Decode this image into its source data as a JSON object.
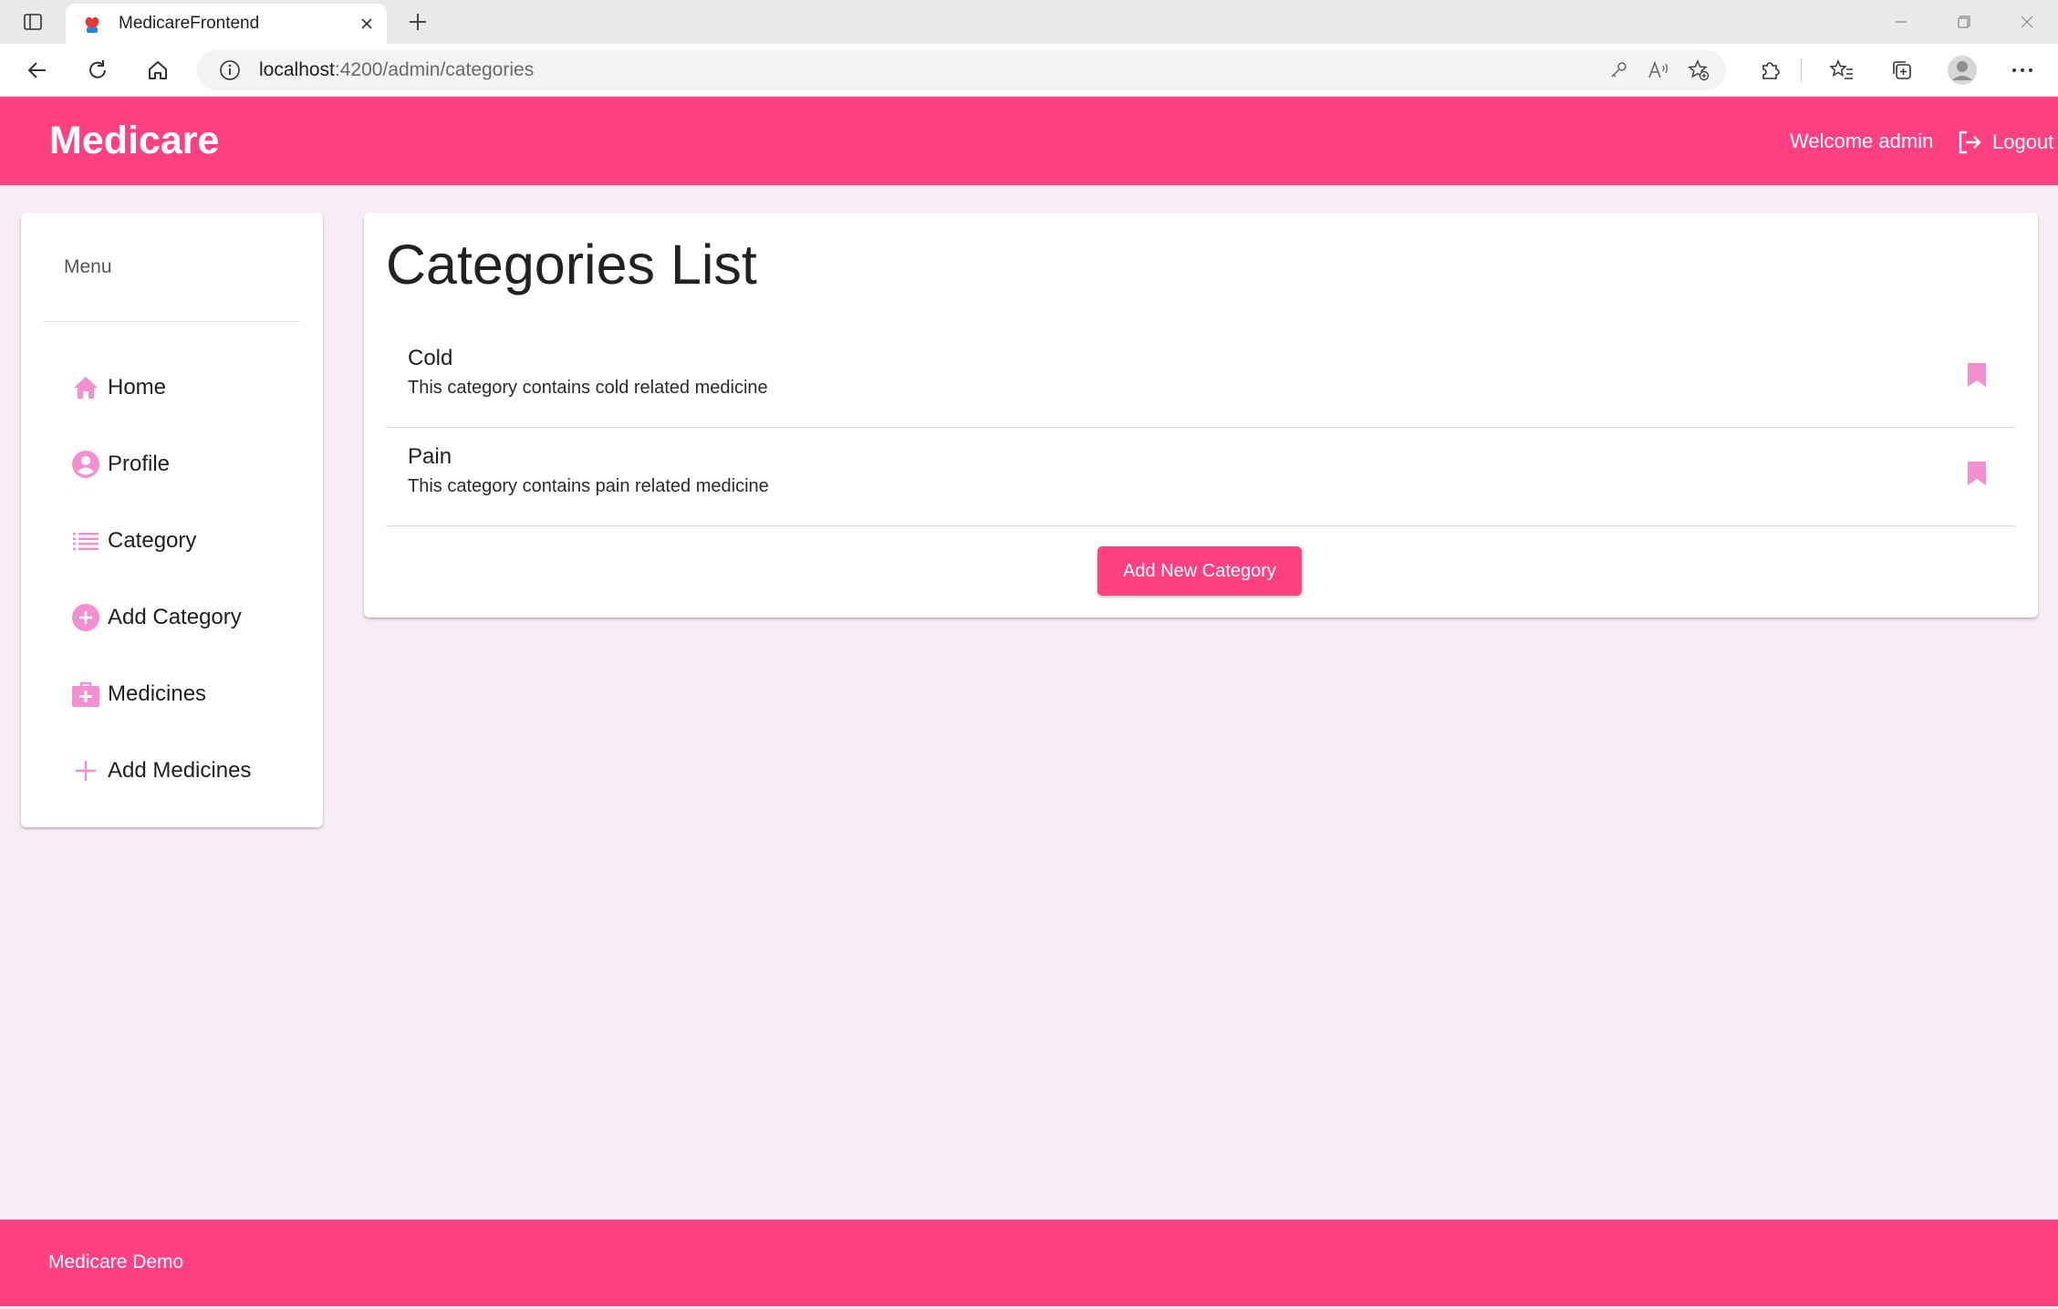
{
  "browser": {
    "tab_title": "MedicareFrontend",
    "url_host": "localhost",
    "url_path": ":4200/admin/categories"
  },
  "header": {
    "brand": "Medicare",
    "welcome": "Welcome admin",
    "logout_label": "Logout"
  },
  "sidebar": {
    "heading": "Menu",
    "items": [
      {
        "label": "Home",
        "icon": "home-icon"
      },
      {
        "label": "Profile",
        "icon": "account-circle-icon"
      },
      {
        "label": "Category",
        "icon": "list-icon"
      },
      {
        "label": "Add Category",
        "icon": "add-circle-icon"
      },
      {
        "label": "Medicines",
        "icon": "medical-kit-icon"
      },
      {
        "label": "Add Medicines",
        "icon": "plus-icon"
      }
    ]
  },
  "main": {
    "title": "Categories List",
    "categories": [
      {
        "name": "Cold",
        "description": "This category contains cold related medicine"
      },
      {
        "name": "Pain",
        "description": "This category contains pain related medicine"
      }
    ],
    "add_button_label": "Add New Category"
  },
  "footer": {
    "text": "Medicare Demo"
  },
  "colors": {
    "primary": "#ff4081",
    "icon_accent": "#f48fd1",
    "background": "#f8edf5"
  }
}
